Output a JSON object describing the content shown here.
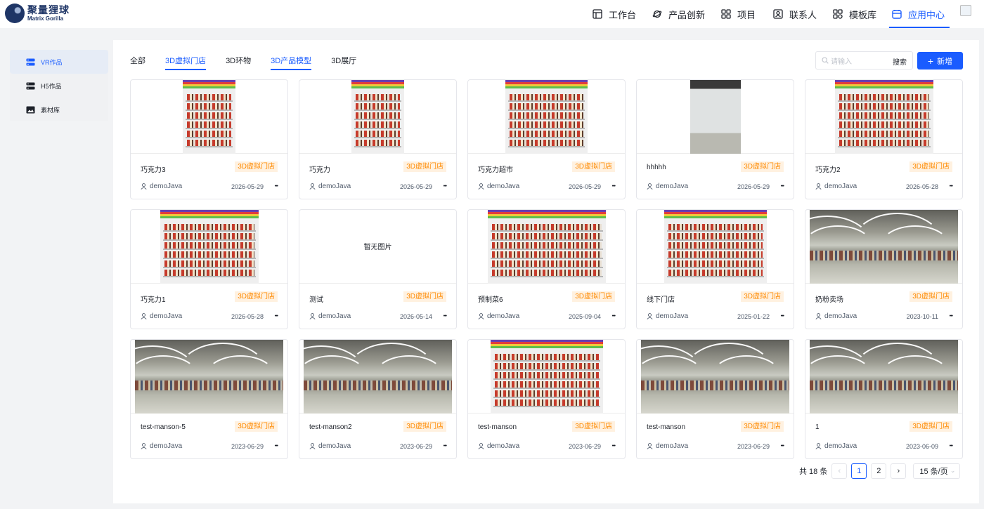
{
  "header": {
    "logo_cn": "聚量狸球",
    "logo_en": "Matrix Gorilla",
    "nav": [
      {
        "label": "工作台",
        "icon": "workbench-icon"
      },
      {
        "label": "产品创新",
        "icon": "innovation-icon"
      },
      {
        "label": "项目",
        "icon": "project-grid-icon"
      },
      {
        "label": "联系人",
        "icon": "contacts-icon"
      },
      {
        "label": "模板库",
        "icon": "template-icon"
      },
      {
        "label": "应用中心",
        "icon": "app-center-icon",
        "active": true
      }
    ]
  },
  "sidebar": {
    "items": [
      {
        "label": "VR作品",
        "icon": "server-icon",
        "active": true
      },
      {
        "label": "H5作品",
        "icon": "server-icon"
      },
      {
        "label": "素材库",
        "icon": "image-icon"
      }
    ]
  },
  "tabs": [
    {
      "label": "全部"
    },
    {
      "label": "3D虚拟门店",
      "active": true
    },
    {
      "label": "3D环物"
    },
    {
      "label": "3D产品模型",
      "active": true
    },
    {
      "label": "3D展厅"
    }
  ],
  "search": {
    "placeholder": "请输入",
    "button": "搜索"
  },
  "add_button": {
    "label": "新增"
  },
  "cards": [
    {
      "title": "巧克力3",
      "tag": "3D虚拟门店",
      "user": "demoJava",
      "date": "2026-05-29",
      "thumb": "shelf"
    },
    {
      "title": "巧克力",
      "tag": "3D虚拟门店",
      "user": "demoJava",
      "date": "2026-05-29",
      "thumb": "shelf"
    },
    {
      "title": "巧克力超市",
      "tag": "3D虚拟门店",
      "user": "demoJava",
      "date": "2026-05-29",
      "thumb": "shelf"
    },
    {
      "title": "hhhhh",
      "tag": "3D虚拟门店",
      "user": "demoJava",
      "date": "2026-05-29",
      "thumb": "fridge"
    },
    {
      "title": "巧克力2",
      "tag": "3D虚拟门店",
      "user": "demoJava",
      "date": "2026-05-28",
      "thumb": "shelf"
    },
    {
      "title": "巧克力1",
      "tag": "3D虚拟门店",
      "user": "demoJava",
      "date": "2026-05-28",
      "thumb": "shelf"
    },
    {
      "title": "测试",
      "tag": "3D虚拟门店",
      "user": "demoJava",
      "date": "2026-05-14",
      "thumb": "none",
      "no_image_text": "暂无图片"
    },
    {
      "title": "预制菜6",
      "tag": "3D虚拟门店",
      "user": "demoJava",
      "date": "2025-09-04",
      "thumb": "shelf"
    },
    {
      "title": "线下门店",
      "tag": "3D虚拟门店",
      "user": "demoJava",
      "date": "2025-01-22",
      "thumb": "shelf"
    },
    {
      "title": "奶粉卖场",
      "tag": "3D虚拟门店",
      "user": "demoJava",
      "date": "2023-10-11",
      "thumb": "pano"
    },
    {
      "title": "test-manson-5",
      "tag": "3D虚拟门店",
      "user": "demoJava",
      "date": "2023-06-29",
      "thumb": "pano"
    },
    {
      "title": "test-manson2",
      "tag": "3D虚拟门店",
      "user": "demoJava",
      "date": "2023-06-29",
      "thumb": "pano"
    },
    {
      "title": "test-manson",
      "tag": "3D虚拟门店",
      "user": "demoJava",
      "date": "2023-06-29",
      "thumb": "shelf"
    },
    {
      "title": "test-manson",
      "tag": "3D虚拟门店",
      "user": "demoJava",
      "date": "2023-06-29",
      "thumb": "pano"
    },
    {
      "title": "1",
      "tag": "3D虚拟门店",
      "user": "demoJava",
      "date": "2023-06-09",
      "thumb": "pano"
    }
  ],
  "pagination": {
    "total": "共 18 条",
    "pages": [
      "1",
      "2"
    ],
    "current": "1",
    "page_size": "15 条/页"
  },
  "colors": {
    "accent": "#1a5cff",
    "tag_text": "#ff8a00",
    "tag_bg": "#fff1e0"
  }
}
